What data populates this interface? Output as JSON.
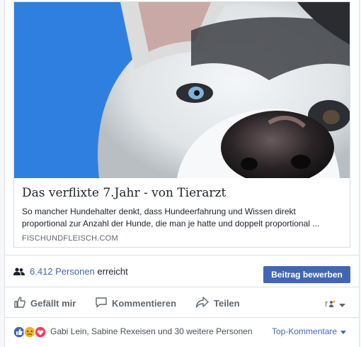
{
  "link": {
    "title": "Das verflixte 7.Jahr - von Tierarzt",
    "description": "So mancher Hundehalter denkt, dass Hundeerfahrung und Wissen direkt proportional zur Anzahl der Hunde, die man je hatte und doppelt proportional ...",
    "domain": "FISCHUNDFLEISCH.COM"
  },
  "reach": {
    "count": "6.412 Personen",
    "suffix": "erreicht",
    "boost_label": "Beitrag bewerben"
  },
  "actions": {
    "like": "Gefällt mir",
    "comment": "Kommentieren",
    "share": "Teilen"
  },
  "reactions": {
    "names": "Gabi Lein, Sabine Rexeisen und 30 weitere Personen",
    "sort_label": "Top-Kommentare"
  },
  "colors": {
    "link_blue": "#4267b2",
    "text": "#1d2129",
    "muted": "#606770",
    "love_red": "#f33e58",
    "sad_yellow": "#f7b125"
  }
}
